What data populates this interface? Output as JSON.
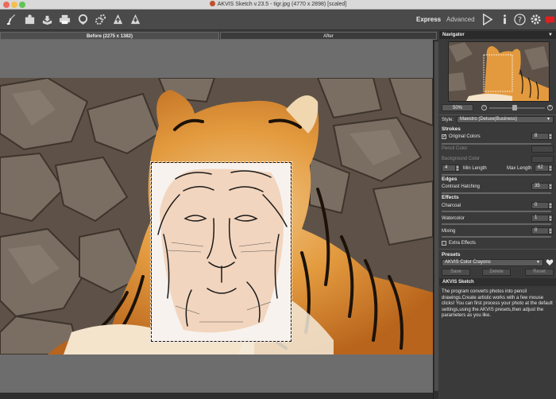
{
  "window": {
    "title": "AKVIS Sketch v.23.5 - tigr.jpg (4770 x 2898) [scaled]"
  },
  "toolbar": {
    "icons": [
      "brush-logo-icon",
      "open-icon",
      "save-icon",
      "print-icon",
      "share-icon",
      "batch-icon",
      "upload-icon",
      "download-icon"
    ],
    "express_label": "Express",
    "advanced_label": "Advanced",
    "right_icons": [
      "run-icon",
      "info-icon",
      "help-icon",
      "settings-icon",
      "notify-icon"
    ]
  },
  "tabs": {
    "before": "Before (2275 x 1382)",
    "after": "After"
  },
  "panel": {
    "navigator": {
      "header": "Navigator",
      "zoom": "50%"
    },
    "style": {
      "label": "Style:",
      "value": "Maestro (Deluxe|Business)"
    },
    "strokes": {
      "header": "Strokes",
      "original_colors": {
        "label": "Original Colors",
        "value": "8"
      },
      "pencil_color": "Pencil Color",
      "background_color": "Background Color",
      "min_length": {
        "value": "4",
        "label": "Min Length"
      },
      "max_length": {
        "label": "Max Length",
        "value": "62"
      }
    },
    "edges": {
      "header": "Edges",
      "contrast_hatching": {
        "label": "Contrast Hatching",
        "value": "35"
      }
    },
    "effects": {
      "header": "Effects",
      "charcoal": {
        "label": "Charcoal",
        "value": "0"
      },
      "watercolor": {
        "label": "Watercolor",
        "value": "1"
      },
      "mixing": {
        "label": "Mixing",
        "value": "0"
      },
      "extra_effects": "Extra Effects"
    },
    "presets": {
      "header": "Presets",
      "selected": "AKVIS Color Crayons",
      "save": "Save",
      "delete": "Delete",
      "reset": "Reset"
    },
    "info": {
      "header": "AKVIS Sketch",
      "text": "The program converts photos into pencil drawings.Create artistic works with a few mouse clicks! You can first process your photo at the default settings,using the AKVIS presets,then adjust the parameters as you like."
    }
  }
}
